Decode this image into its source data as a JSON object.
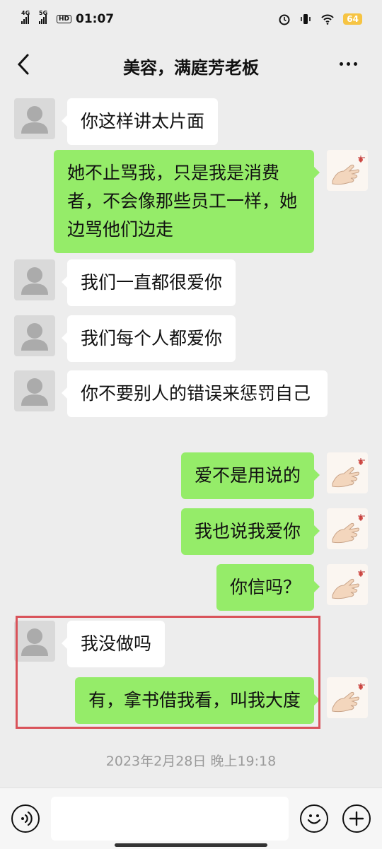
{
  "status_bar": {
    "net1": "4G",
    "net2": "5G",
    "hd": "HD",
    "time": "01:07",
    "battery": "64"
  },
  "header": {
    "title": "美容，满庭芳老板"
  },
  "messages": [
    {
      "side": "in",
      "text": "你这样讲太片面"
    },
    {
      "side": "out",
      "text": "她不止骂我，只是我是消费者，不会像那些员工一样，她边骂他们边走"
    },
    {
      "side": "in",
      "text": "我们一直都很爱你"
    },
    {
      "side": "in",
      "text": "我们每个人都爱你"
    },
    {
      "side": "in",
      "text": "你不要别人的错误来惩罚自己"
    },
    {
      "side": "out",
      "text": "爱不是用说的"
    },
    {
      "side": "out",
      "text": "我也说我爱你"
    },
    {
      "side": "out",
      "text": "你信吗？"
    },
    {
      "side": "in",
      "text": "我没做吗"
    },
    {
      "side": "out",
      "text": "有，拿书借我看，叫我大度"
    }
  ],
  "timestamp": "2023年2月28日 晚上19:18",
  "input": {
    "placeholder": ""
  },
  "icons": {
    "back": "back-chevron-icon",
    "more": "more-dots-icon",
    "voice": "voice-icon",
    "emoji": "emoji-icon",
    "plus": "plus-icon"
  },
  "colors": {
    "outgoing_bubble": "#95ec69",
    "incoming_bubble": "#ffffff",
    "highlight_box": "#d9535a",
    "background": "#ededed"
  }
}
